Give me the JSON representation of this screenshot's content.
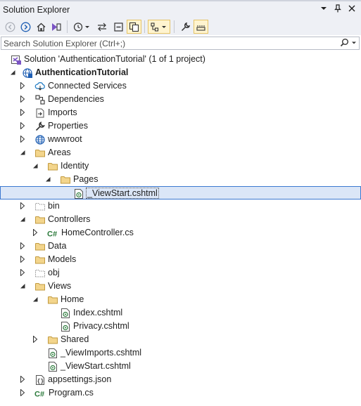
{
  "panel": {
    "title": "Solution Explorer",
    "colors": {
      "title_bg": "#eef0f5",
      "selection_bg": "#dbe6f7",
      "selection_border": "#3b78d0",
      "folder": "#dcb66a"
    }
  },
  "search": {
    "placeholder": "Search Solution Explorer (Ctrl+;)"
  },
  "tree": [
    {
      "label": "Solution 'AuthenticationTutorial' (1 of 1 project)",
      "icon": "solution-icon",
      "level": 0,
      "expander": "none"
    },
    {
      "label": "AuthenticationTutorial",
      "icon": "web-project-icon",
      "level": 0,
      "expander": "expanded",
      "bold": true
    },
    {
      "label": "Connected Services",
      "icon": "connected-services-icon",
      "level": 1,
      "expander": "collapsed"
    },
    {
      "label": "Dependencies",
      "icon": "dependencies-icon",
      "level": 1,
      "expander": "collapsed"
    },
    {
      "label": "Imports",
      "icon": "imports-icon",
      "level": 1,
      "expander": "collapsed"
    },
    {
      "label": "Properties",
      "icon": "properties-icon",
      "level": 1,
      "expander": "collapsed"
    },
    {
      "label": "wwwroot",
      "icon": "globe-icon",
      "level": 1,
      "expander": "collapsed"
    },
    {
      "label": "Areas",
      "icon": "folder-icon",
      "level": 1,
      "expander": "expanded"
    },
    {
      "label": "Identity",
      "icon": "folder-icon",
      "level": 2,
      "expander": "expanded"
    },
    {
      "label": "Pages",
      "icon": "folder-icon",
      "level": 3,
      "expander": "expanded"
    },
    {
      "label": "_ViewStart.cshtml",
      "icon": "razor-file-icon",
      "level": 4,
      "expander": "none",
      "selected": true,
      "dashed": true
    },
    {
      "label": "bin",
      "icon": "folder-dotted-icon",
      "level": 1,
      "expander": "collapsed"
    },
    {
      "label": "Controllers",
      "icon": "folder-icon",
      "level": 1,
      "expander": "expanded"
    },
    {
      "label": "HomeController.cs",
      "icon": "csharp-file-icon",
      "level": 2,
      "expander": "collapsed"
    },
    {
      "label": "Data",
      "icon": "folder-icon",
      "level": 1,
      "expander": "collapsed"
    },
    {
      "label": "Models",
      "icon": "folder-icon",
      "level": 1,
      "expander": "collapsed"
    },
    {
      "label": "obj",
      "icon": "folder-dotted-icon",
      "level": 1,
      "expander": "collapsed"
    },
    {
      "label": "Views",
      "icon": "folder-icon",
      "level": 1,
      "expander": "expanded"
    },
    {
      "label": "Home",
      "icon": "folder-icon",
      "level": 2,
      "expander": "expanded"
    },
    {
      "label": "Index.cshtml",
      "icon": "razor-file-icon",
      "level": 3,
      "expander": "none"
    },
    {
      "label": "Privacy.cshtml",
      "icon": "razor-file-icon",
      "level": 3,
      "expander": "none"
    },
    {
      "label": "Shared",
      "icon": "folder-icon",
      "level": 2,
      "expander": "collapsed"
    },
    {
      "label": "_ViewImports.cshtml",
      "icon": "razor-file-icon",
      "level": 2,
      "expander": "none"
    },
    {
      "label": "_ViewStart.cshtml",
      "icon": "razor-file-icon",
      "level": 2,
      "expander": "none"
    },
    {
      "label": "appsettings.json",
      "icon": "json-file-icon",
      "level": 1,
      "expander": "collapsed"
    },
    {
      "label": "Program.cs",
      "icon": "csharp-file-icon",
      "level": 1,
      "expander": "collapsed"
    }
  ]
}
